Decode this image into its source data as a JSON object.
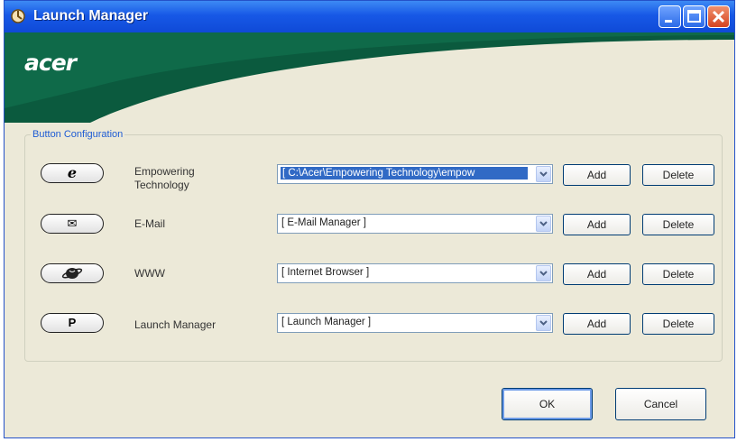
{
  "window": {
    "title": "Launch Manager",
    "brand_logo": "acer",
    "colors": {
      "titlebar": "#1758e6",
      "brand_green": "#0b5a3e",
      "group_caption": "#1d5bd4"
    }
  },
  "group": {
    "caption": "Button Configuration",
    "rows": [
      {
        "button_icon": "e-icon",
        "button_glyph": "e",
        "label_line1": "Empowering",
        "label_line2": "Technology",
        "combo_value": "[ C:\\Acer\\Empowering Technology\\empow",
        "combo_selected": true,
        "add_label": "Add",
        "delete_label": "Delete"
      },
      {
        "button_icon": "mail-icon",
        "button_glyph": "✉",
        "label_line1": "E-Mail",
        "label_line2": "",
        "combo_value": "[ E-Mail Manager ]",
        "combo_selected": false,
        "add_label": "Add",
        "delete_label": "Delete"
      },
      {
        "button_icon": "globe-icon",
        "button_glyph": "",
        "label_line1": "WWW",
        "label_line2": "",
        "combo_value": "[ Internet Browser ]",
        "combo_selected": false,
        "add_label": "Add",
        "delete_label": "Delete"
      },
      {
        "button_icon": "p-icon",
        "button_glyph": "P",
        "label_line1": "Launch Manager",
        "label_line2": "",
        "combo_value": "[ Launch Manager ]",
        "combo_selected": false,
        "add_label": "Add",
        "delete_label": "Delete"
      }
    ]
  },
  "footer": {
    "ok_label": "OK",
    "cancel_label": "Cancel"
  }
}
